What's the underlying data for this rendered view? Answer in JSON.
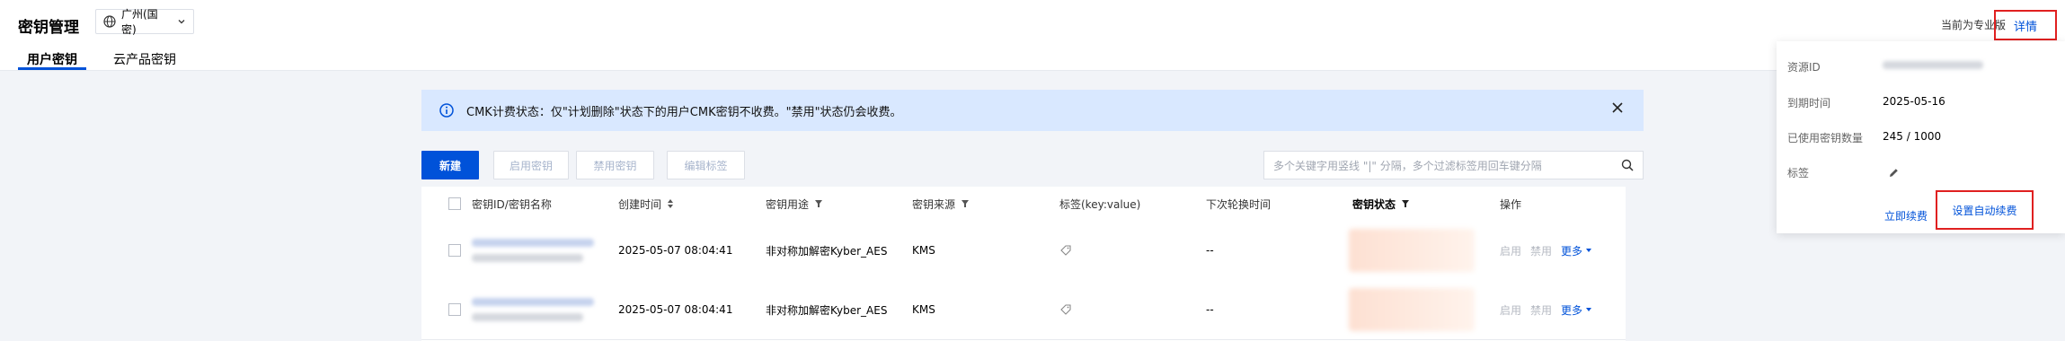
{
  "header": {
    "title": "密钥管理",
    "region": "广州(国密)",
    "tabs": [
      {
        "label": "用户密钥",
        "active": true
      },
      {
        "label": "云产品密钥",
        "active": false
      }
    ],
    "pro_text": "当前为专业版",
    "detail_link": "详情"
  },
  "notice": {
    "text": "CMK计费状态：仅\"计划删除\"状态下的用户CMK密钥不收费。\"禁用\"状态仍会收费。",
    "icon": "info-circle-icon"
  },
  "toolbar": {
    "new_label": "新建",
    "enable_label": "启用密钥",
    "disable_label": "禁用密钥",
    "edit_tags_label": "编辑标签",
    "search_placeholder": "多个关键字用竖线 \"|\" 分隔，多个过滤标签用回车键分隔"
  },
  "table": {
    "columns": [
      "密钥ID/密钥名称",
      "创建时间",
      "密钥用途",
      "密钥来源",
      "标签(key:value)",
      "下次轮换时间",
      "密钥状态",
      "操作"
    ],
    "rows": [
      {
        "created": "2025-05-07 08:04:41",
        "usage": "非对称加解密Kyber_AES",
        "source": "KMS",
        "next_rotation": "--",
        "ops": {
          "enable": "启用",
          "disable": "禁用",
          "more": "更多"
        }
      },
      {
        "created": "2025-05-07 08:04:41",
        "usage": "非对称加解密Kyber_AES",
        "source": "KMS",
        "next_rotation": "--",
        "ops": {
          "enable": "启用",
          "disable": "禁用",
          "more": "更多"
        }
      }
    ]
  },
  "panel": {
    "resource_id_label": "资源ID",
    "expiry_label": "到期时间",
    "expiry_value": "2025-05-16",
    "used_keys_label": "已使用密钥数量",
    "used_keys_value": "245 / 1000",
    "tags_label": "标签",
    "renew_now": "立即续费",
    "auto_renew": "设置自动续费"
  },
  "colors": {
    "brand": "#0052d9",
    "notice_bg": "#d9e8ff",
    "highlight_border": "#e02020"
  }
}
